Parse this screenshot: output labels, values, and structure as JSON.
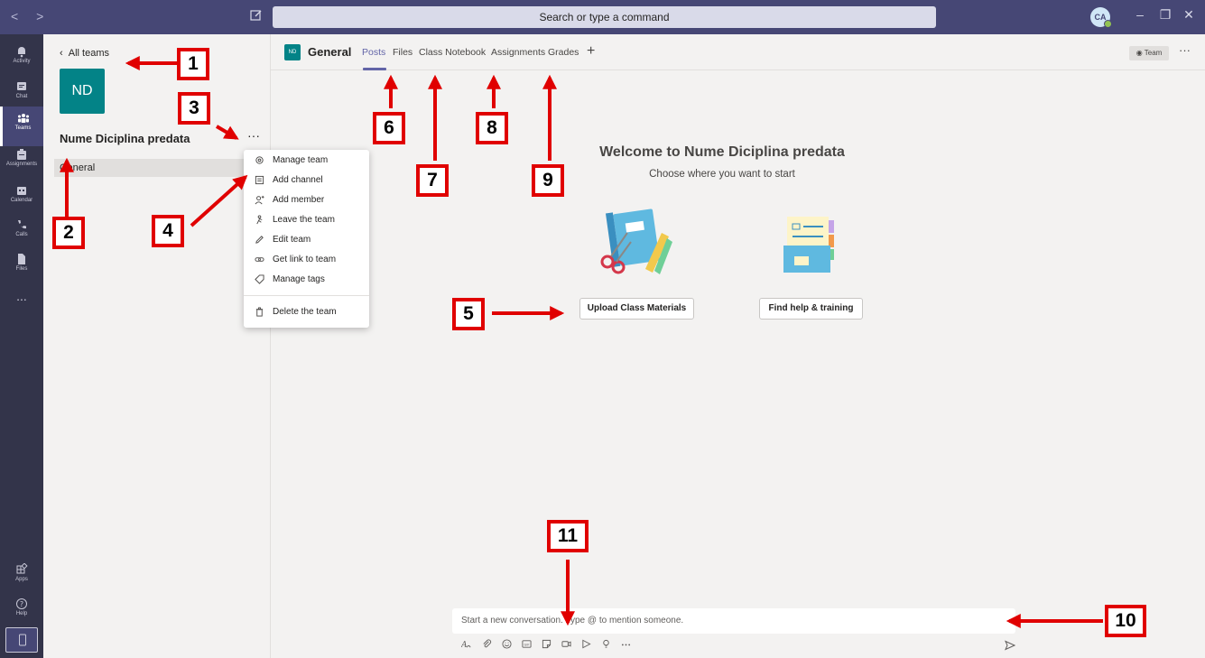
{
  "titlebar": {
    "search_placeholder": "Search or type a command",
    "avatar_initials": "CA",
    "brand_color": "#464775"
  },
  "rail": {
    "items": [
      {
        "label": "Activity",
        "icon": "bell-icon"
      },
      {
        "label": "Chat",
        "icon": "chat-icon"
      },
      {
        "label": "Teams",
        "icon": "teams-icon"
      },
      {
        "label": "Assignments",
        "icon": "assignments-icon"
      },
      {
        "label": "Calendar",
        "icon": "calendar-icon"
      },
      {
        "label": "Calls",
        "icon": "phone-icon"
      },
      {
        "label": "Files",
        "icon": "file-icon"
      }
    ],
    "more": "...",
    "bottom": [
      {
        "label": "Apps",
        "icon": "apps-icon"
      },
      {
        "label": "Help",
        "icon": "help-icon"
      }
    ]
  },
  "team_panel": {
    "back_label": "All teams",
    "team_initials": "ND",
    "team_name": "Nume Diciplina predata",
    "more": "···",
    "channel": "General"
  },
  "context_menu": {
    "items": [
      {
        "label": "Manage team",
        "icon": "gear-icon"
      },
      {
        "label": "Add channel",
        "icon": "channel-icon"
      },
      {
        "label": "Add member",
        "icon": "add-person-icon"
      },
      {
        "label": "Leave the team",
        "icon": "leave-icon"
      },
      {
        "label": "Edit team",
        "icon": "pencil-icon"
      },
      {
        "label": "Get link to team",
        "icon": "link-icon"
      },
      {
        "label": "Manage tags",
        "icon": "tag-icon"
      },
      {
        "label": "Delete the team",
        "icon": "trash-icon"
      }
    ]
  },
  "header": {
    "channel_initials": "ND",
    "channel_name": "General",
    "tabs": [
      "Posts",
      "Files",
      "Class Notebook",
      "Assignments",
      "Grades"
    ],
    "active_tab": "Posts",
    "add_tab": "+",
    "team_button": "Team",
    "more": "···"
  },
  "welcome": {
    "title": "Welcome to Nume Diciplina predata",
    "subtitle": "Choose where you want to start",
    "upload_button": "Upload Class Materials",
    "help_button": "Find help & training"
  },
  "compose": {
    "placeholder": "Start a new conversation. Type @ to mention someone.",
    "tools": [
      "format-icon",
      "attach-icon",
      "emoji-icon",
      "gif-icon",
      "sticker-icon",
      "meet-icon",
      "stream-icon",
      "praise-icon",
      "more-icon"
    ]
  },
  "annotations": [
    "1",
    "2",
    "3",
    "4",
    "5",
    "6",
    "7",
    "8",
    "9",
    "10",
    "11"
  ],
  "colors": {
    "accent": "#6264a7",
    "team_color": "#038387",
    "annotation_red": "#e00000"
  }
}
